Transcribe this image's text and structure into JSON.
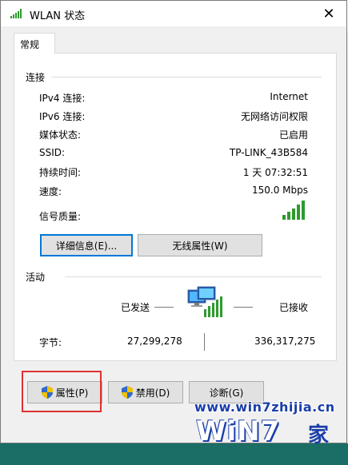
{
  "window": {
    "title": "WLAN 状态",
    "close_glyph": "✕"
  },
  "tabs": [
    {
      "label": "常规"
    }
  ],
  "connection": {
    "section_title": "连接",
    "rows": [
      {
        "label": "IPv4 连接:",
        "value": "Internet"
      },
      {
        "label": "IPv6 连接:",
        "value": "无网络访问权限"
      },
      {
        "label": "媒体状态:",
        "value": "已启用"
      },
      {
        "label": "SSID:",
        "value": "TP-LINK_43B584"
      },
      {
        "label": "持续时间:",
        "value": "1 天 07:32:51"
      },
      {
        "label": "速度:",
        "value": "150.0 Mbps"
      }
    ],
    "signal_label": "信号质量:",
    "signal_bars": 5,
    "details_button": "详细信息(E)...",
    "wireless_props_button": "无线属性(W)"
  },
  "activity": {
    "section_title": "活动",
    "sent_label": "已发送",
    "received_label": "已接收",
    "bytes_label": "字节:",
    "bytes_sent": "27,299,278",
    "bytes_received": "336,317,275"
  },
  "buttons": {
    "properties": "属性(P)",
    "disable": "禁用(D)",
    "diagnose": "诊断(G)"
  },
  "watermark": {
    "url": "www.win7zhijia.cn",
    "logo": "WiN7",
    "suffix": "家"
  },
  "colors": {
    "accent": "#0078d7",
    "highlight_box": "#e03030",
    "signal_green": "#2e9a2e"
  }
}
